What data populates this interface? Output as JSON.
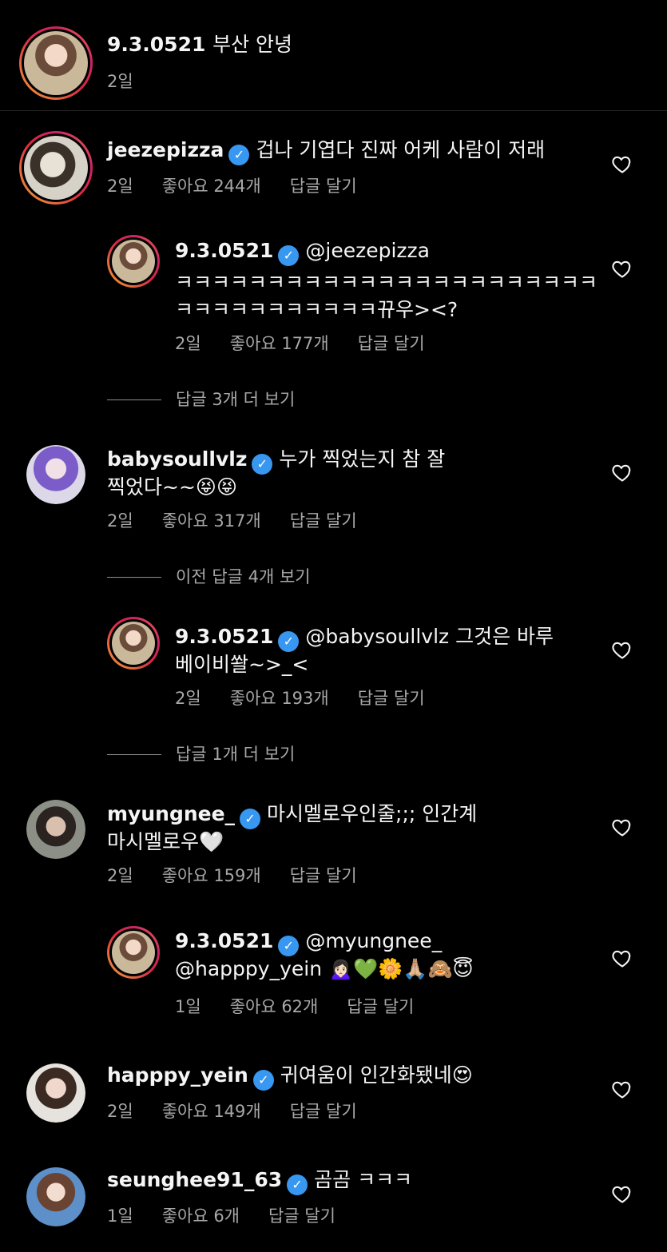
{
  "caption": {
    "username": "9.3.0521",
    "text": "부산 안녕",
    "time": "2일"
  },
  "comments": [
    {
      "username": "jeezepizza",
      "text": "겁나 기엽다 진짜 어케 사람이 저래",
      "time": "2일",
      "likes": "좋아요 244개",
      "reply": "답글 달기"
    },
    {
      "username": "9.3.0521",
      "mention": "@jeezepizza",
      "text1": "ㅋㅋㅋㅋㅋㅋㅋㅋㅋㅋㅋㅋㅋㅋㅋㅋㅋㅋㅋㅋㅋㅋㅋ",
      "text2": "ㅋㅋㅋㅋㅋㅋㅋㅋㅋㅋㅋ뀨우><?",
      "time": "2일",
      "likes": "좋아요 177개",
      "reply": "답글 달기"
    },
    {
      "more": "답글 3개 더 보기"
    },
    {
      "username": "babysoullvlz",
      "text1": "누가 찍었는지 참 잘",
      "text2": "찍었다~~😝😝",
      "time": "2일",
      "likes": "좋아요 317개",
      "reply": "답글 달기"
    },
    {
      "more": "이전 답글 4개 보기"
    },
    {
      "username": "9.3.0521",
      "text1": "@babysoullvlz 그것은 바루",
      "text2": "베이비쏼~>_<",
      "time": "2일",
      "likes": "좋아요 193개",
      "reply": "답글 달기"
    },
    {
      "more": "답글 1개 더 보기"
    },
    {
      "username": "myungnee_",
      "text1": "마시멜로우인줄;;; 인간계",
      "text2": "마시멜로우🤍",
      "time": "2일",
      "likes": "좋아요 159개",
      "reply": "답글 달기"
    },
    {
      "username": "9.3.0521",
      "text1": "@myungnee_",
      "text2": "@happpy_yein 🙍🏻‍♀️💚🌼🙏🏼🙈😇",
      "time": "1일",
      "likes": "좋아요 62개",
      "reply": "답글 달기"
    },
    {
      "username": "happpy_yein",
      "text": "귀여움이 인간화됐네😍",
      "time": "2일",
      "likes": "좋아요 149개",
      "reply": "답글 달기"
    },
    {
      "username": "seunghee91_63",
      "text": "곰곰 ㅋㅋㅋ",
      "time": "1일",
      "likes": "좋아요 6개",
      "reply": "답글 달기"
    }
  ],
  "icons": {
    "verified": "verified-badge-icon",
    "heart": "heart-outline-icon"
  },
  "colors": {
    "verified": "#3897f0",
    "meta": "#a8a8a8",
    "story_ring": "#e6683c"
  }
}
